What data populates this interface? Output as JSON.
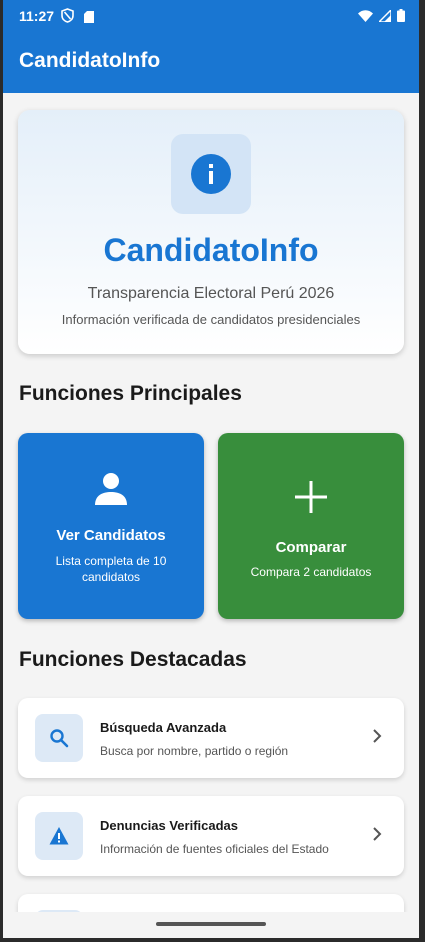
{
  "status_bar": {
    "time": "11:27"
  },
  "app_bar": {
    "title": "CandidatoInfo"
  },
  "hero": {
    "name": "CandidatoInfo",
    "subtitle": "Transparencia Electoral Perú 2026",
    "description": "Información verificada de candidatos presidenciales",
    "icon": "info-icon"
  },
  "main_functions": {
    "title": "Funciones Principales",
    "tiles": [
      {
        "icon": "person-icon",
        "title": "Ver Candidatos",
        "subtitle": "Lista completa de 10 candidatos",
        "color": "#1976d2"
      },
      {
        "icon": "plus-icon",
        "title": "Comparar",
        "subtitle": "Compara 2 candidatos",
        "color": "#388e3c"
      }
    ]
  },
  "featured": {
    "title": "Funciones Destacadas",
    "items": [
      {
        "icon": "search-icon",
        "title": "Búsqueda Avanzada",
        "subtitle": "Busca por nombre, partido o región"
      },
      {
        "icon": "warning-icon",
        "title": "Denuncias Verificadas",
        "subtitle": "Información de fuentes oficiales del Estado"
      }
    ]
  },
  "colors": {
    "primary": "#1976d2",
    "green": "#388e3c"
  }
}
